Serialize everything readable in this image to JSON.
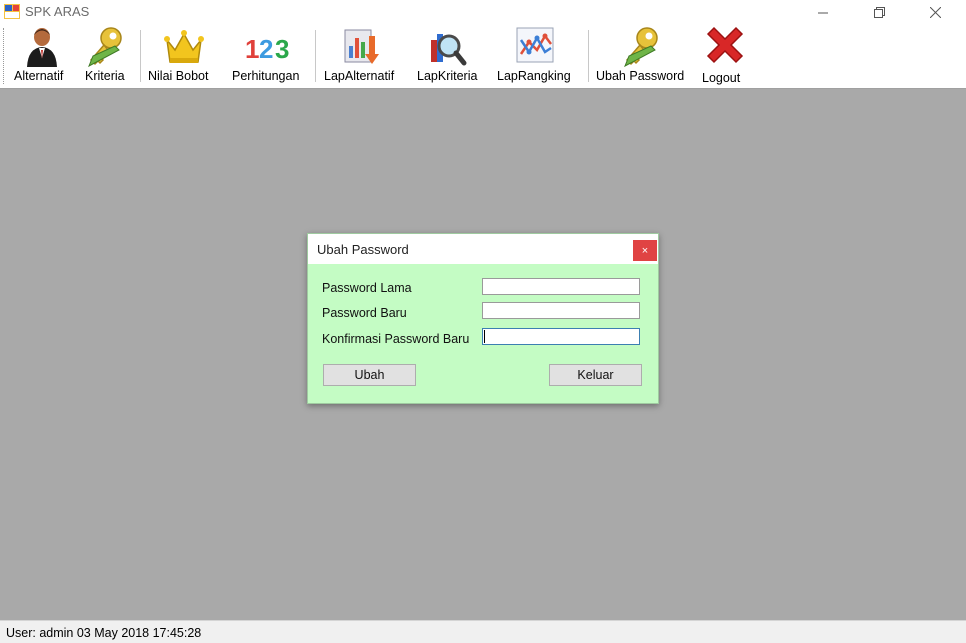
{
  "window": {
    "title": "SPK ARAS"
  },
  "toolbar": {
    "items": [
      {
        "label": "Alternatif",
        "icon": "user-icon"
      },
      {
        "label": "Kriteria",
        "icon": "key-pencil-icon"
      },
      {
        "label": "Nilai Bobot",
        "icon": "crown-icon"
      },
      {
        "label": "Perhitungan",
        "icon": "numbers-123-icon"
      },
      {
        "label": "LapAlternatif",
        "icon": "report-chart-icon"
      },
      {
        "label": "LapKriteria",
        "icon": "magnifier-report-icon"
      },
      {
        "label": "LapRangking",
        "icon": "line-chart-icon"
      },
      {
        "label": "Ubah Password",
        "icon": "key-pencil-icon"
      },
      {
        "label": "Logout",
        "icon": "red-x-icon"
      }
    ]
  },
  "dialog": {
    "title": "Ubah Password",
    "close_glyph": "×",
    "fields": [
      {
        "label": "Password Lama",
        "value": ""
      },
      {
        "label": "Password Baru",
        "value": ""
      },
      {
        "label": "Konfirmasi Password Baru",
        "value": ""
      }
    ],
    "ubah_label": "Ubah",
    "keluar_label": "Keluar"
  },
  "status": {
    "text": "User: admin  03 May 2018 17:45:28"
  },
  "colors": {
    "mdi_background": "#a9a9a9",
    "dialog_background": "#c4fcc4",
    "close_red": "#e04343"
  }
}
